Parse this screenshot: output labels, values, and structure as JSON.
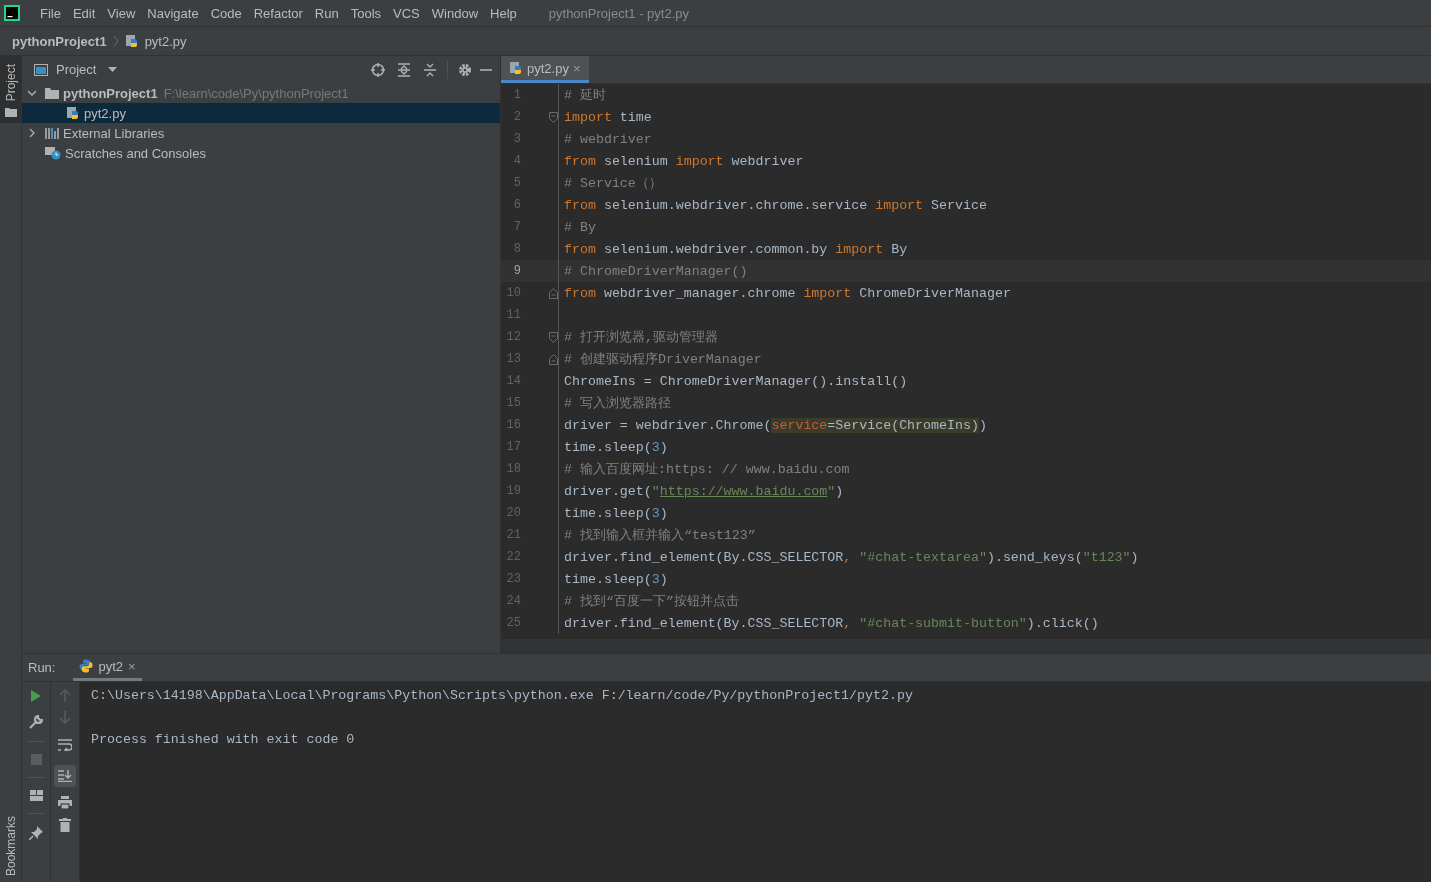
{
  "menu": [
    "File",
    "Edit",
    "View",
    "Navigate",
    "Code",
    "Refactor",
    "Run",
    "Tools",
    "VCS",
    "Window",
    "Help"
  ],
  "window": {
    "title": "pythonProject1 - pyt2.py"
  },
  "breadcrumb": {
    "project": "pythonProject1",
    "file": "pyt2.py"
  },
  "stripe": {
    "top_tab": {
      "label": "Project",
      "selected": true
    },
    "bottom_tab": {
      "label": "Bookmarks",
      "selected": false
    }
  },
  "project_panel": {
    "title": "Project",
    "tree": [
      {
        "kind": "folder",
        "label": "pythonProject1",
        "path": "F:\\learn\\code\\Py\\pythonProject1",
        "expanded": true,
        "selected": false,
        "children": [
          {
            "kind": "python",
            "label": "pyt2.py",
            "selected": true
          }
        ]
      },
      {
        "kind": "libraries",
        "label": "External Libraries",
        "expanded": false,
        "selected": false
      },
      {
        "kind": "scratches",
        "label": "Scratches and Consoles",
        "selected": false
      }
    ]
  },
  "editor": {
    "tabs": [
      {
        "label": "pyt2.py",
        "selected": true,
        "close": "×"
      }
    ],
    "lines": [
      {
        "number": "1",
        "current": false,
        "fold_start": false,
        "fold_end": false,
        "tokens": [
          {
            "kind": "comment",
            "text": "# 延时"
          }
        ]
      },
      {
        "number": "2",
        "current": false,
        "fold_start": true,
        "fold_end": false,
        "tokens": [
          {
            "kind": "keyword",
            "text": "import"
          },
          {
            "kind": "plain",
            "text": " time"
          }
        ]
      },
      {
        "number": "3",
        "current": false,
        "fold_start": false,
        "fold_end": false,
        "tokens": [
          {
            "kind": "comment",
            "text": "# webdriver"
          }
        ]
      },
      {
        "number": "4",
        "current": false,
        "fold_start": false,
        "fold_end": false,
        "tokens": [
          {
            "kind": "keyword",
            "text": "from"
          },
          {
            "kind": "plain",
            "text": " selenium "
          },
          {
            "kind": "keyword",
            "text": "import"
          },
          {
            "kind": "plain",
            "text": " webdriver"
          }
        ]
      },
      {
        "number": "5",
        "current": false,
        "fold_start": false,
        "fold_end": false,
        "tokens": [
          {
            "kind": "comment",
            "text": "# Service（）"
          }
        ]
      },
      {
        "number": "6",
        "current": false,
        "fold_start": false,
        "fold_end": false,
        "tokens": [
          {
            "kind": "keyword",
            "text": "from"
          },
          {
            "kind": "plain",
            "text": " selenium.webdriver.chrome.service "
          },
          {
            "kind": "keyword",
            "text": "import"
          },
          {
            "kind": "plain",
            "text": " Service"
          }
        ]
      },
      {
        "number": "7",
        "current": false,
        "fold_start": false,
        "fold_end": false,
        "tokens": [
          {
            "kind": "comment",
            "text": "# By"
          }
        ]
      },
      {
        "number": "8",
        "current": false,
        "fold_start": false,
        "fold_end": false,
        "tokens": [
          {
            "kind": "keyword",
            "text": "from"
          },
          {
            "kind": "plain",
            "text": " selenium.webdriver.common.by "
          },
          {
            "kind": "keyword",
            "text": "import"
          },
          {
            "kind": "plain",
            "text": " By"
          }
        ]
      },
      {
        "number": "9",
        "current": true,
        "fold_start": false,
        "fold_end": false,
        "tokens": [
          {
            "kind": "comment",
            "text": "# ChromeDriverManager()"
          }
        ]
      },
      {
        "number": "10",
        "current": false,
        "fold_start": false,
        "fold_end": true,
        "tokens": [
          {
            "kind": "keyword",
            "text": "from"
          },
          {
            "kind": "plain",
            "text": " webdriver_manager.chrome "
          },
          {
            "kind": "keyword",
            "text": "import"
          },
          {
            "kind": "plain",
            "text": " ChromeDriverManager"
          }
        ]
      },
      {
        "number": "11",
        "current": false,
        "fold_start": false,
        "fold_end": false
      },
      {
        "number": "12",
        "current": false,
        "fold_start": true,
        "fold_end": false,
        "tokens": [
          {
            "kind": "comment",
            "text": "# 打开浏览器,驱动管理器"
          }
        ]
      },
      {
        "number": "13",
        "current": false,
        "fold_start": false,
        "fold_end": true,
        "tokens": [
          {
            "kind": "comment",
            "text": "# 创建驱动程序DriverManager"
          }
        ]
      },
      {
        "number": "14",
        "current": false,
        "fold_start": false,
        "fold_end": false,
        "tokens": [
          {
            "kind": "plain",
            "text": "ChromeIns = ChromeDriverManager().install()"
          }
        ]
      },
      {
        "number": "15",
        "current": false,
        "fold_start": false,
        "fold_end": false,
        "tokens": [
          {
            "kind": "comment",
            "text": "# 写入浏览器路径"
          }
        ]
      },
      {
        "number": "16",
        "current": false,
        "fold_start": false,
        "fold_end": false,
        "tokens": [
          {
            "kind": "plain",
            "text": "driver = webdriver.Chrome("
          },
          {
            "kind": "param_hl",
            "text": "service"
          },
          {
            "kind": "plain_hl",
            "text": "=Service(ChromeIns)"
          },
          {
            "kind": "plain",
            "text": ")"
          }
        ]
      },
      {
        "number": "17",
        "current": false,
        "fold_start": false,
        "fold_end": false,
        "tokens": [
          {
            "kind": "plain",
            "text": "time.sleep("
          },
          {
            "kind": "number",
            "text": "3"
          },
          {
            "kind": "plain",
            "text": ")"
          }
        ]
      },
      {
        "number": "18",
        "current": false,
        "fold_start": false,
        "fold_end": false,
        "tokens": [
          {
            "kind": "comment",
            "text": "# 输入百度网址:https: // www.baidu.com"
          }
        ]
      },
      {
        "number": "19",
        "current": false,
        "fold_start": false,
        "fold_end": false,
        "tokens": [
          {
            "kind": "plain",
            "text": "driver.get("
          },
          {
            "kind": "string",
            "text": "\""
          },
          {
            "kind": "link",
            "text": "https://www.baidu.com"
          },
          {
            "kind": "string",
            "text": "\""
          },
          {
            "kind": "plain",
            "text": ")"
          }
        ]
      },
      {
        "number": "20",
        "current": false,
        "fold_start": false,
        "fold_end": false,
        "tokens": [
          {
            "kind": "plain",
            "text": "time.sleep("
          },
          {
            "kind": "number",
            "text": "3"
          },
          {
            "kind": "plain",
            "text": ")"
          }
        ]
      },
      {
        "number": "21",
        "current": false,
        "fold_start": false,
        "fold_end": false,
        "tokens": [
          {
            "kind": "comment",
            "text": "# 找到输入框并输入“test123”"
          }
        ]
      },
      {
        "number": "22",
        "current": false,
        "fold_start": false,
        "fold_end": false,
        "tokens": [
          {
            "kind": "plain",
            "text": "driver.find_element(By.CSS_SELECTOR"
          },
          {
            "kind": "keyword",
            "text": ", "
          },
          {
            "kind": "string",
            "text": "\"#chat-textarea\""
          },
          {
            "kind": "plain",
            "text": ").send_keys("
          },
          {
            "kind": "string",
            "text": "\"t123\""
          },
          {
            "kind": "plain",
            "text": ")"
          }
        ]
      },
      {
        "number": "23",
        "current": false,
        "fold_start": false,
        "fold_end": false,
        "tokens": [
          {
            "kind": "plain",
            "text": "time.sleep("
          },
          {
            "kind": "number",
            "text": "3"
          },
          {
            "kind": "plain",
            "text": ")"
          }
        ]
      },
      {
        "number": "24",
        "current": false,
        "fold_start": false,
        "fold_end": false,
        "tokens": [
          {
            "kind": "comment",
            "text": "# 找到“百度一下”按钮并点击"
          }
        ]
      },
      {
        "number": "25",
        "current": false,
        "fold_start": false,
        "fold_end": false,
        "tokens": [
          {
            "kind": "plain",
            "text": "driver.find_element(By.CSS_SELECTOR"
          },
          {
            "kind": "keyword",
            "text": ", "
          },
          {
            "kind": "string",
            "text": "\"#chat-submit-button\""
          },
          {
            "kind": "plain",
            "text": ").click()"
          }
        ]
      }
    ]
  },
  "run_panel": {
    "label": "Run:",
    "tab": {
      "label": "pyt2",
      "close": "×",
      "selected": true
    },
    "scroll_to_end_on": true,
    "soft_wrap_on": false,
    "console": [
      "C:\\Users\\14198\\AppData\\Local\\Programs\\Python\\Scripts\\python.exe F:/learn/code/Py/pythonProject1/pyt2.py",
      "Process finished with exit code 0"
    ]
  }
}
